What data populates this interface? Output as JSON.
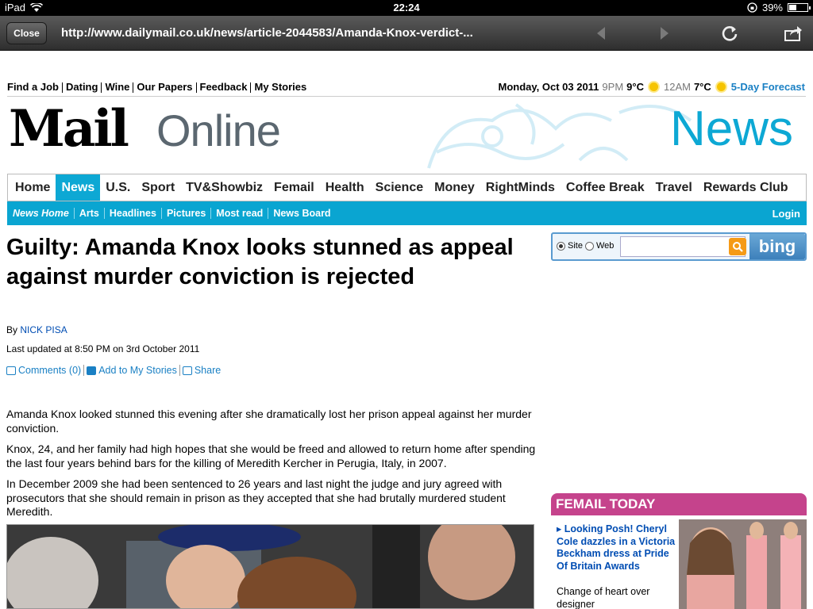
{
  "status_bar": {
    "device": "iPad",
    "time": "22:24",
    "battery": "39%",
    "battery_level": 0.39
  },
  "browser": {
    "close_label": "Close",
    "url": "http://www.dailymail.co.uk/news/article-2044583/Amanda-Knox-verdict-..."
  },
  "top_links": [
    "Find a Job",
    "Dating",
    "Wine",
    "Our Papers",
    "Feedback",
    "My Stories"
  ],
  "weather": {
    "date": "Monday, Oct 03 2011",
    "time1": "9PM",
    "temp1": "9°C",
    "time2": "12AM",
    "temp2": "7°C",
    "forecast": "5-Day Forecast"
  },
  "masthead": {
    "mail": "Mail",
    "online": "Online",
    "section": "News"
  },
  "nav": {
    "items": [
      "Home",
      "News",
      "U.S.",
      "Sport",
      "TV&Showbiz",
      "Femail",
      "Health",
      "Science",
      "Money",
      "RightMinds",
      "Coffee Break",
      "Travel",
      "Rewards Club"
    ],
    "active": "News"
  },
  "subnav": {
    "items": [
      "News Home",
      "Arts",
      "Headlines",
      "Pictures",
      "Most read",
      "News Board"
    ],
    "login": "Login"
  },
  "article": {
    "headline": "Guilty: Amanda Knox looks stunned as appeal against murder conviction is rejected",
    "by": "By",
    "author": "NICK PISA",
    "updated": "Last updated at 8:50 PM on 3rd October 2011",
    "comments": "Comments (0)",
    "add_stories": "Add to My Stories",
    "share": "Share",
    "paragraphs": [
      "Amanda Knox looked stunned this evening after she dramatically lost her prison appeal against her murder conviction.",
      "Knox, 24, and her family had high hopes that she would be freed and allowed to return home after spending the last four years behind bars for the killing of Meredith Kercher in Perugia, Italy, in 2007.",
      "In December 2009 she had been sentenced to 26 years and last night the judge and jury agreed with prosecutors that she should remain in prison as they accepted that she had brutally murdered student Meredith."
    ]
  },
  "search": {
    "site": "Site",
    "web": "Web",
    "brand": "bing"
  },
  "femail": {
    "title": "FEMAIL TODAY",
    "link": "Looking Posh! Cheryl Cole dazzles in a Victoria Beckham dress at Pride Of Britain Awards",
    "sub": "Change of heart over designer"
  },
  "colors": {
    "accent": "#0da8d4",
    "femail": "#c5438c",
    "link": "#1a80c4"
  }
}
